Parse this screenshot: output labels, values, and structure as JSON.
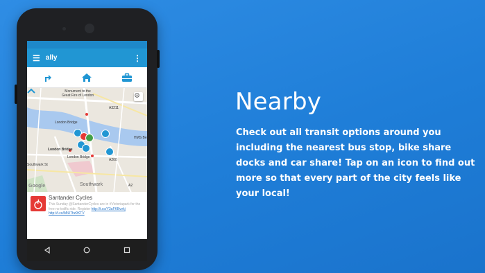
{
  "app": {
    "title": "ally",
    "menu_icon": "hamburger-menu-icon",
    "more_icon": "overflow-menu-icon"
  },
  "tabs": [
    {
      "name": "directions",
      "icon": "directions-icon"
    },
    {
      "name": "home",
      "icon": "home-icon"
    },
    {
      "name": "work",
      "icon": "briefcase-icon"
    }
  ],
  "map": {
    "labels": {
      "monument": "Monument to the\nGreat Fire of London",
      "a3211": "A3211",
      "london_bridge_n": "London Bridge",
      "hms": "HMS Be",
      "london_bridge_w": "London Bridge",
      "london_bridge_s": "London Bridge",
      "a200": "A200",
      "southwark_st": "Southwark St",
      "southwark": "Southwark",
      "google": "Google",
      "a2": "A2"
    }
  },
  "card": {
    "title": "Santander Cycles",
    "logo_text": "Santander",
    "body_text": "This Sunday @SantanderCycles are in #Victoriapark for the free no traffic ride. Register ",
    "link_1": "http://t.co/Y3aFKBvvkj",
    "link_2": "http://t.co/MtU7hz9KTV"
  },
  "navbar": {
    "back": "back-icon",
    "home": "home-circle-icon",
    "recents": "recents-icon"
  },
  "feature": {
    "heading": "Nearby",
    "description": "Check out all transit options around you including the nearest bus stop, bike share docks and car share! Tap on an icon to find out more so that every part of the city feels like your local!"
  },
  "colors": {
    "background": "#2384dd",
    "app_bar": "#2196d3",
    "status_bar": "#1e88c9",
    "accent": "#2a77c9",
    "santander_red": "#e53935"
  }
}
